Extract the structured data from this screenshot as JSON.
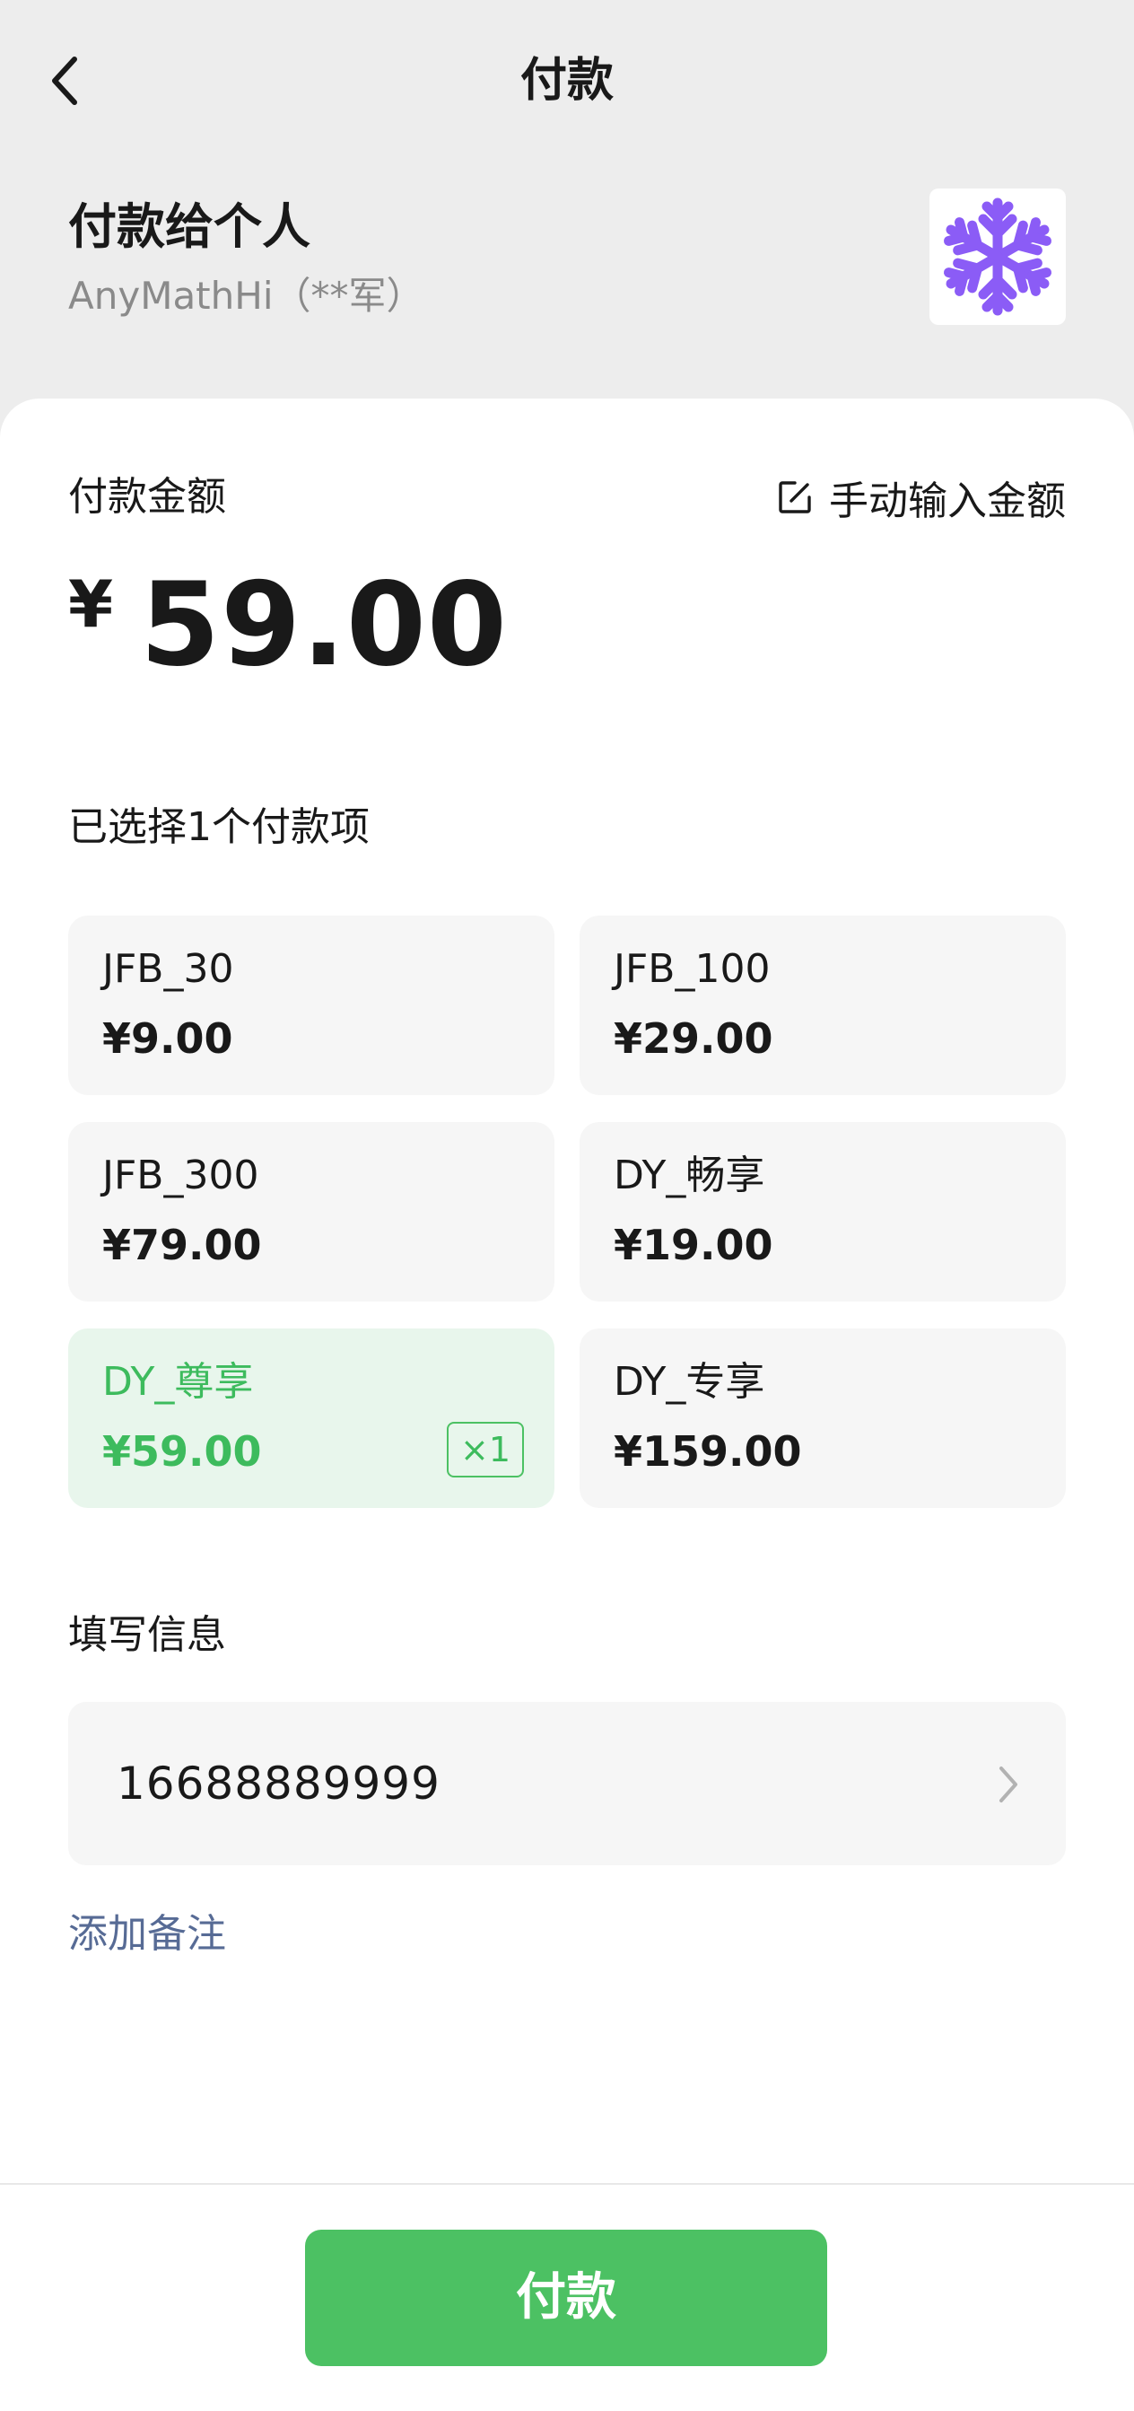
{
  "header": {
    "title": "付款",
    "back_icon": "chevron-left-icon"
  },
  "payee": {
    "title": "付款给个人",
    "name": "AnyMathHi（**军）",
    "avatar_icon": "snowflake-icon",
    "avatar_color": "#8b5cf6"
  },
  "amount": {
    "label": "付款金额",
    "manual_entry": "手动输入金额",
    "manual_icon": "edit-icon",
    "currency": "¥",
    "value": "59.00"
  },
  "selection": {
    "summary": "已选择1个付款项",
    "items": [
      {
        "name": "JFB_30",
        "price": "¥9.00",
        "selected": false
      },
      {
        "name": "JFB_100",
        "price": "¥29.00",
        "selected": false
      },
      {
        "name": "JFB_300",
        "price": "¥79.00",
        "selected": false
      },
      {
        "name": "DY_畅享",
        "price": "¥19.00",
        "selected": false
      },
      {
        "name": "DY_尊享",
        "price": "¥59.00",
        "selected": true,
        "quantity": "×1"
      },
      {
        "name": "DY_专享",
        "price": "¥159.00",
        "selected": false
      }
    ]
  },
  "info": {
    "label": "填写信息",
    "value": "16688889999",
    "chevron_icon": "chevron-right-icon"
  },
  "note": {
    "label": "添加备注"
  },
  "footer": {
    "pay_label": "付款"
  },
  "colors": {
    "accent": "#4cc163",
    "accent_text": "#3dbb5d",
    "selected_bg": "#e8f6ec",
    "link": "#576b95",
    "background": "#ededed"
  }
}
